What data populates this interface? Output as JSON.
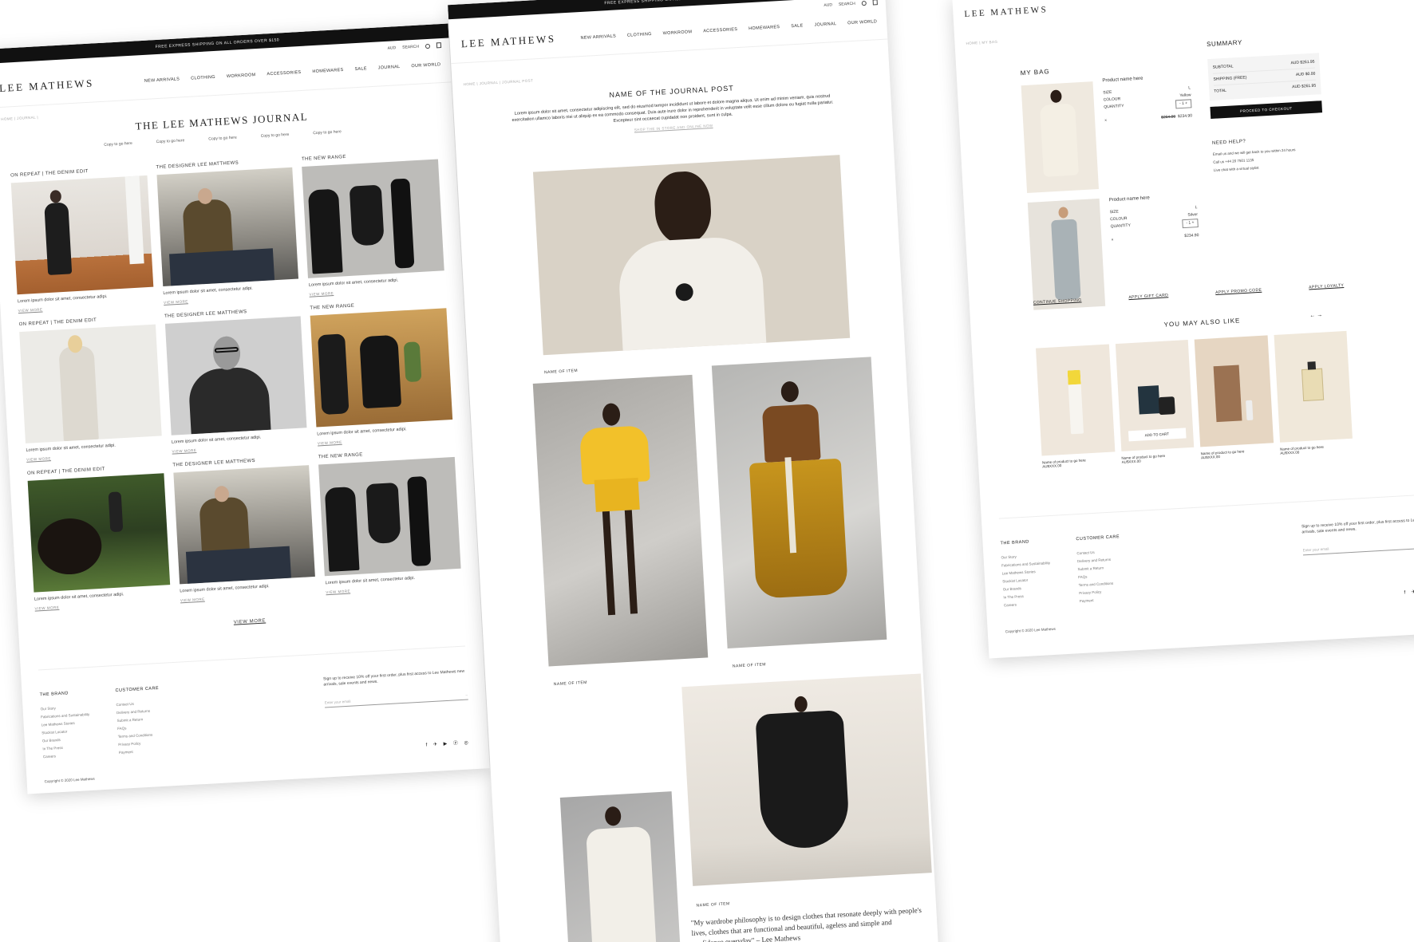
{
  "shared": {
    "promo": "FREE EXPRESS SHIPPING ON ALL ORDERS OVER $150",
    "logo": "LEE MATHEWS",
    "currency": "AUD",
    "search": "SEARCH",
    "nav": [
      "NEW ARRIVALS",
      "CLOTHING",
      "WORKROOM",
      "ACCESSORIES",
      "HOMEWARES",
      "SALE",
      "JOURNAL",
      "OUR WORLD"
    ]
  },
  "journal": {
    "breadcrumb": "HOME  |  JOURNAL  |",
    "title": "THE LEE MATHEWS JOURNAL",
    "copy_links": [
      "Copy to go here",
      "Copy to go here",
      "Copy to go here",
      "Copy to go here",
      "Copy to go here"
    ],
    "cards": [
      {
        "category": "ON REPEAT | THE DENIM EDIT",
        "desc": "Lorem ipsum dolor sit amet, consectetur adipi.",
        "more": "VIEW MORE"
      },
      {
        "category": "THE DESIGNER LEE MATTHEWS",
        "desc": "Lorem ipsum dolor sit amet, consectetur adipi.",
        "more": "VIEW MORE"
      },
      {
        "category": "THE NEW RANGE",
        "desc": "Lorem ipsum dolor sit amet, consectetur adipi.",
        "more": "VIEW MORE"
      },
      {
        "category": "ON REPEAT | THE DENIM EDIT",
        "desc": "Lorem ipsum dolor sit amet, consectetur adipi.",
        "more": "VIEW MORE"
      },
      {
        "category": "THE DESIGNER LEE MATTHEWS",
        "desc": "Lorem ipsum dolor sit amet, consectetur adipi.",
        "more": "VIEW MORE"
      },
      {
        "category": "THE NEW RANGE",
        "desc": "Lorem ipsum dolor sit amet, consectetur adipi.",
        "more": "VIEW MORE"
      },
      {
        "category": "ON REPEAT | THE DENIM EDIT",
        "desc": "Lorem ipsum dolor sit amet, consectetur adipi.",
        "more": "VIEW MORE"
      },
      {
        "category": "THE DESIGNER LEE MATTHEWS",
        "desc": "Lorem ipsum dolor sit amet, consectetur adipi.",
        "more": "VIEW MORE"
      },
      {
        "category": "THE NEW RANGE",
        "desc": "Lorem ipsum dolor sit amet, consectetur adipi.",
        "more": "VIEW MORE"
      }
    ],
    "view_more": "VIEW MORE"
  },
  "footer": {
    "brand_title": "THE BRAND",
    "brand_links": [
      "Our Story",
      "Fabrications and Sustainability",
      "Lee Mathews Stories",
      "Stockist Locator",
      "Our Brands",
      "In The Press",
      "Careers"
    ],
    "care_title": "CUSTOMER CARE",
    "care_links": [
      "Contact Us",
      "Delivery and Returns",
      "Submit a Return",
      "FAQs",
      "Terms and Conditions",
      "Privacy Policy",
      "Payment"
    ],
    "signup_text": "Sign up to receive 10% off your first order, plus first access to Lee Mathews new arrivals, sale events and news.",
    "email_placeholder": "Enter your email",
    "arrow": "→",
    "social": "f ✈ ▶ ⓟ ◎",
    "copyright": "Copyright © 2020 Lee Mathews"
  },
  "post": {
    "breadcrumb": "HOME  |  JOURNAL  |  JOURNAL POST",
    "title": "NAME OF THE JOURNAL POST",
    "body": "Lorem ipsum dolor sit amet, consectetur adipiscing elit, sed do eiusmod tempor incididunt ut labore et dolore magna aliqua. Ut enim ad minim veniam, quis nostrud exercitation ullamco laboris nisi ut aliquip ex ea commodo consequat. Duis aute irure dolor in reprehenderit in voluptate velit esse cillum dolore eu fugiat nulla pariatur. Excepteur sint occaecat cupidatat non proident, sunt in culpa.",
    "link": "SHOP THE IN STORE AND ONLINE NOW",
    "item_caption": "NAME OF ITEM",
    "quote": "\"My wardrobe philosophy is to design clothes that resonate deeply with people's lives, clothes that are functional and beautiful, ageless and simple and confidence everyday\" – Lee Mathews"
  },
  "bag": {
    "breadcrumb": "HOME  |  MY BAG",
    "title": "MY BAG",
    "items": [
      {
        "name": "Product name here",
        "size_label": "SIZE",
        "size": "L",
        "colour_label": "COLOUR",
        "colour": "Yellow",
        "qty_label": "QUANTITY",
        "qty": "- 1 +",
        "price_old": "$264.90",
        "price": "$234.90"
      },
      {
        "name": "Product name here",
        "size_label": "SIZE",
        "size": "L",
        "colour_label": "COLOUR",
        "colour": "Silver",
        "qty_label": "QUANTITY",
        "qty": "- 1 +",
        "price": "$234.90"
      }
    ],
    "remove": "×",
    "summary_title": "SUMMARY",
    "summary_rows": [
      {
        "label": "SUBTOTAL",
        "value": "AUD $261.95"
      },
      {
        "label": "SHIPPING (FREE)",
        "value": "AUD $0.00"
      },
      {
        "label": "TOTAL",
        "value": "AUD $261.95"
      }
    ],
    "checkout": "PROCEED TO CHECKOUT",
    "help_title": "NEED HELP?",
    "help_lines": [
      "Email us and we will get back to you within 24 hours",
      "Call us +44 20 7501 1135",
      "Live chat with a virtual stylist"
    ],
    "links": [
      "CONTINUE SHOPPING",
      "APPLY GIFT CARD",
      "APPLY PROMO CODE",
      "APPLY LOYALTY"
    ],
    "ymal_title": "YOU MAY ALSO LIKE",
    "carousel_prev": "←",
    "carousel_next": "→",
    "add_to_cart": "ADD TO CART",
    "products": [
      {
        "name": "Name of product to go here",
        "price": "AU$XXX.00"
      },
      {
        "name": "Name of product to go here",
        "price": "AU$XXX.00"
      },
      {
        "name": "Name of product to go here",
        "price": "AU$XXX.00"
      },
      {
        "name": "Name of product to go here",
        "price": "AU$XXX.00"
      }
    ]
  }
}
